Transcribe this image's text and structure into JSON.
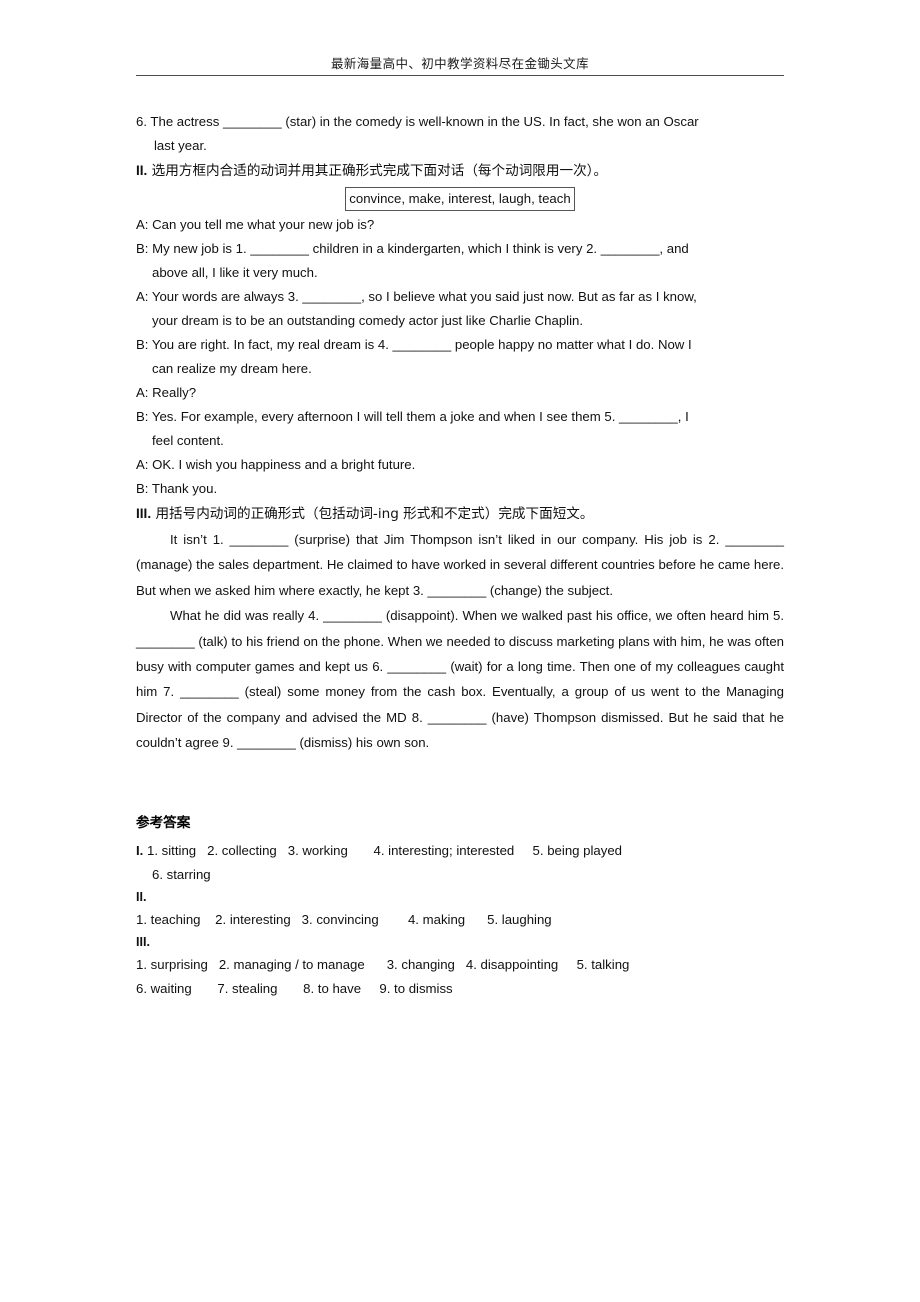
{
  "header": {
    "watermark": "最新海量高中、初中教学资料尽在金锄头文库"
  },
  "exercise": {
    "item6": {
      "line1": "6. The actress ________ (star) in the comedy is well-known in the US. In fact, she won an Oscar",
      "line2": "last year."
    },
    "section2": {
      "numeral": "II.",
      "heading": "选用方框内合适的动词并用其正确形式完成下面对话（每个动词限用一次）。",
      "wordbank": "convince, make, interest, laugh, teach",
      "dialogue": [
        {
          "line1": "A: Can you tell me what your new job is?",
          "line2": ""
        },
        {
          "line1": "B: My new job is 1. ________ children in a kindergarten, which I think is very 2. ________, and",
          "line2": "above all, I like it very much."
        },
        {
          "line1": "A: Your words are always 3. ________, so I believe what you said just now. But as far as I know,",
          "line2": "your dream is to be an outstanding comedy actor just like Charlie Chaplin."
        },
        {
          "line1": "B: You are right. In fact, my real dream is 4. ________ people happy no matter what I do. Now I",
          "line2": "can realize my dream here."
        },
        {
          "line1": "A: Really?",
          "line2": ""
        },
        {
          "line1": "B: Yes. For example, every afternoon I will tell them a joke and when I see them 5. ________, I",
          "line2": "feel content."
        },
        {
          "line1": "A: OK. I wish you happiness and a bright future.",
          "line2": ""
        },
        {
          "line1": "B: Thank you.",
          "line2": ""
        }
      ]
    },
    "section3": {
      "numeral": "III.",
      "heading": "用括号内动词的正确形式（包括动词-ing 形式和不定式）完成下面短文。",
      "paragraph1": "It isn’t 1. ________ (surprise) that Jim Thompson isn’t liked in our company. His job is 2. ________ (manage) the sales department. He claimed to have worked in several different countries before he came here. But when we asked him where exactly, he kept 3. ________ (change) the subject.",
      "paragraph2": "What he did was really 4. ________ (disappoint). When we walked past his office, we often heard him 5. ________ (talk) to his friend on the phone. When we needed to discuss marketing plans with him, he was often busy with computer games and kept us 6. ________ (wait) for a long time. Then one of my colleagues caught him 7. ________ (steal) some money from the cash box. Eventually, a group of us went to the Managing Director of the company and advised the MD 8. ________ (have) Thompson dismissed. But he said that he couldn’t agree 9. ________ (dismiss) his own son."
    }
  },
  "answer_key": {
    "title": "参考答案",
    "section1": {
      "numeral": "I.",
      "line1": "1. sitting   2. collecting   3. working       4. interesting; interested     5. being played",
      "line2": "6. starring"
    },
    "section2": {
      "numeral": "II.",
      "line1": "1. teaching    2. interesting   3. convincing        4. making      5. laughing"
    },
    "section3": {
      "numeral": "III.",
      "line1": "1. surprising   2. managing / to manage      3. changing   4. disappointing     5. talking",
      "line2": "6. waiting       7. stealing       8. to have     9. to dismiss"
    }
  }
}
